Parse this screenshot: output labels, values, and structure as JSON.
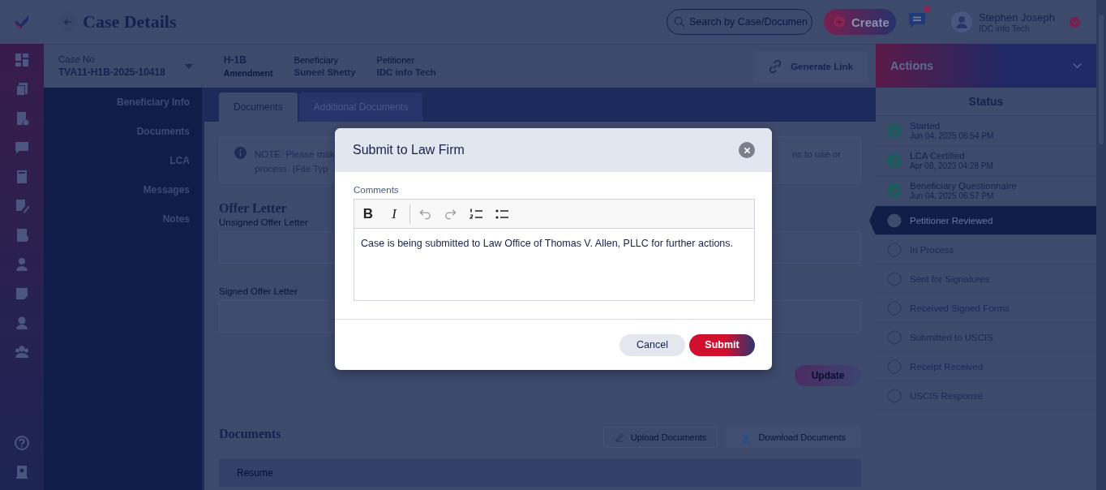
{
  "header": {
    "title": "Case Details",
    "search": {
      "placeholder": "Search by Case/Documen"
    },
    "create_button": "Create",
    "chat": {
      "unread": true
    },
    "user": {
      "name": "Stephen Joseph",
      "company": "IDC info Tech"
    }
  },
  "case_bar": {
    "case_no_label": "Case No",
    "case_no": "TVA11-H1B-2025-10418",
    "visa": {
      "type": "H-1B",
      "subtype": "Amendment"
    },
    "fields": [
      {
        "label": "Beneficiary",
        "value": "Suneel Shetty"
      },
      {
        "label": "Petitioner",
        "value": "IDC info Tech"
      }
    ],
    "generate_link": "Generate Link"
  },
  "left_nav": [
    "Beneficiary Info",
    "Documents",
    "LCA",
    "Messages",
    "Notes"
  ],
  "tabs": [
    {
      "label": "Documents",
      "selected": true
    },
    {
      "label": "Additional Documents",
      "selected": false
    }
  ],
  "note": {
    "left": [
      "NOTE: Please mak",
      "process. (File Typ"
    ],
    "right": [
      "ns to use or"
    ]
  },
  "offer_letter": {
    "title": "Offer Letter",
    "fields": [
      "Unsigned Offer Letter",
      "Signed Offer Letter"
    ],
    "update_button": {
      "label": "Update",
      "disabled": true
    }
  },
  "documents": {
    "title": "Documents",
    "upload_button": "Upload Documents",
    "download_button": "Download Documents",
    "rows": [
      "Resume"
    ]
  },
  "actions": {
    "title": "Actions",
    "status_title": "Status",
    "steps": [
      {
        "label": "Started",
        "date": "Jun 04, 2025 06:54 PM",
        "done": true,
        "selected": false
      },
      {
        "label": "LCA Certified",
        "date": "Apr 08, 2023 04:28 PM",
        "done": true,
        "selected": false
      },
      {
        "label": "Beneficiary Questionnaire",
        "date": "Jun 04, 2025 06:57 PM",
        "done": true,
        "selected": false
      },
      {
        "label": "Petitioner Reviewed",
        "done": false,
        "selected": true
      },
      {
        "label": "In Process",
        "done": false,
        "selected": false
      },
      {
        "label": "Sent for Signatures",
        "done": false,
        "selected": false
      },
      {
        "label": "Received Signed Forms",
        "done": false,
        "selected": false
      },
      {
        "label": "Submitted to USCIS",
        "done": false,
        "selected": false
      },
      {
        "label": "Receipt Received",
        "done": false,
        "selected": false
      },
      {
        "label": "USCIS Response",
        "done": false,
        "selected": false
      }
    ]
  },
  "modal": {
    "title": "Submit to Law Firm",
    "comments_label": "Comments",
    "toolbar": [
      "B",
      "I"
    ],
    "comment": "Case is being submitted to Law Office of Thomas V. Allen, PLLC for further actions.",
    "buttons": [
      {
        "label": "Cancel",
        "kind": "secondary"
      },
      {
        "label": "Submit",
        "kind": "primary"
      }
    ]
  }
}
